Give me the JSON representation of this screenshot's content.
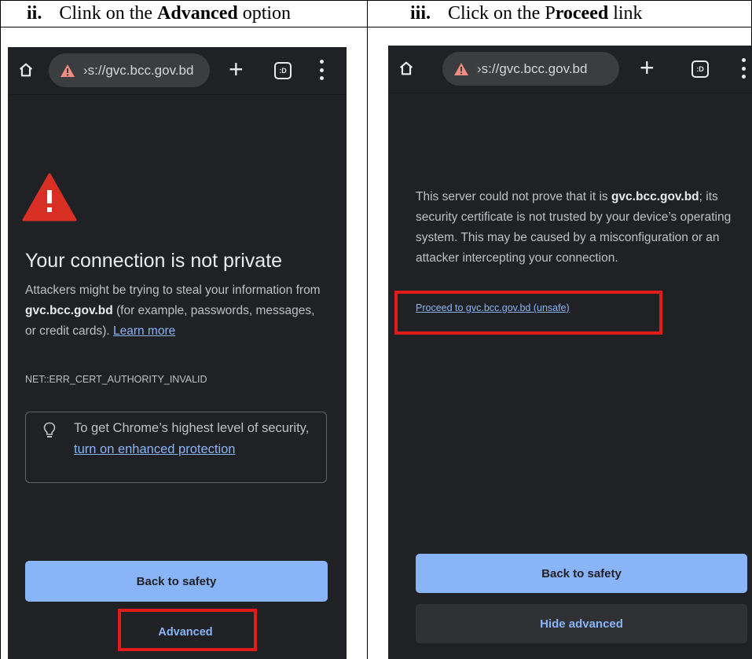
{
  "table": {
    "left_header": {
      "number": "ii.",
      "text_before": "Clink on the ",
      "text_bold": "Advanced",
      "text_after": " option"
    },
    "right_header": {
      "number": "iii.",
      "text_before": "Click on the P",
      "text_bold": "roceed",
      "text_after": " link"
    }
  },
  "browser": {
    "url": "›s://gvc.bcc.gov.bd",
    "tabs_label": ":D"
  },
  "left_phone": {
    "title": "Your connection is not private",
    "para_before": "Attackers might be trying to steal your information from ",
    "para_domain": "gvc.bcc.gov.bd",
    "para_after": " (for example, passwords, messages, or credit cards). ",
    "learn_more": "Learn more",
    "error_code": "NET::ERR_CERT_AUTHORITY_INVALID",
    "tip_before": "To get Chrome’s highest level of security, ",
    "tip_link": "turn on enhanced protection",
    "back_button": "Back to safety",
    "advanced_button": "Advanced"
  },
  "right_phone": {
    "para_before": "This server could not prove that it is ",
    "para_domain": "gvc.bcc.gov.bd",
    "para_after": "; its security certificate is not trusted by your device’s operating system. This may be caused by a misconfiguration or an attacker intercepting your connection.",
    "proceed_link": "Proceed to gvc.bcc.gov.bd (unsafe)",
    "back_button": "Back to safety",
    "hide_advanced_button": "Hide advanced"
  },
  "colors": {
    "page_bg": "#202124",
    "accent": "#8ab4f8",
    "warning": "#d93025",
    "highlight": "#e11a1a"
  }
}
